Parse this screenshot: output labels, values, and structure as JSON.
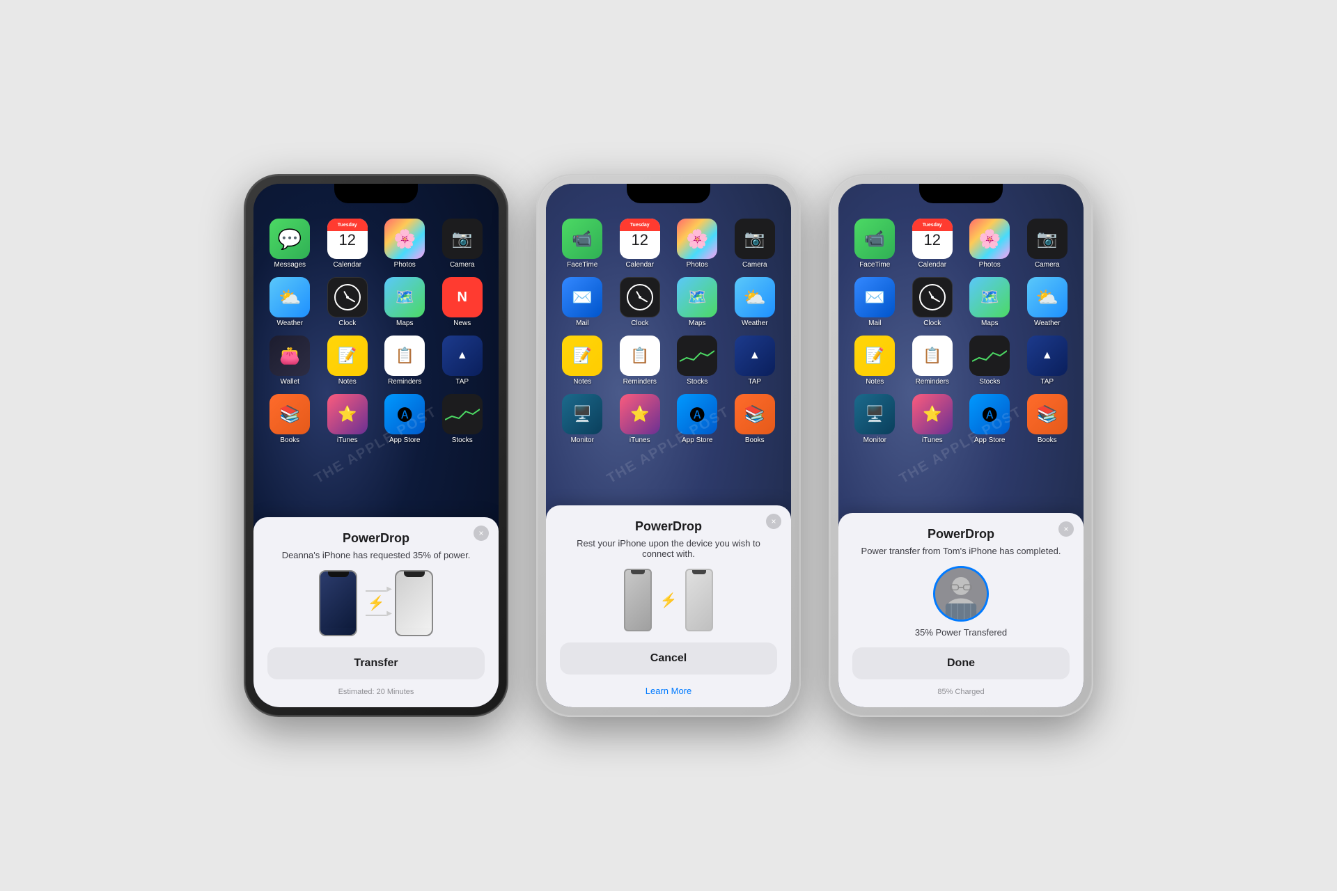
{
  "phones": [
    {
      "id": "phone1",
      "frameStyle": "dark",
      "modal": {
        "title": "PowerDrop",
        "subtitle": "Deanna's iPhone has requested 35% of power.",
        "primaryButton": "Transfer",
        "footnote": "Estimated: 20 Minutes",
        "type": "transfer",
        "closeLabel": "×"
      }
    },
    {
      "id": "phone2",
      "frameStyle": "light",
      "modal": {
        "title": "PowerDrop",
        "subtitle": "Rest your iPhone upon the device you wish to connect with.",
        "primaryButton": "Cancel",
        "learnMore": "Learn More",
        "type": "resting",
        "closeLabel": "×"
      }
    },
    {
      "id": "phone3",
      "frameStyle": "light",
      "modal": {
        "title": "PowerDrop",
        "subtitle": "Power transfer from Tom's iPhone has completed.",
        "primaryButton": "Done",
        "powerPercent": "35% Power Transfered",
        "footnote": "85% Charged",
        "type": "complete",
        "closeLabel": "×"
      }
    }
  ],
  "apps": {
    "row1_phone1": [
      "Messages",
      "Calendar",
      "Photos",
      "Camera"
    ],
    "row2_phone1": [
      "Weather",
      "Clock",
      "Maps",
      "News"
    ],
    "row3_phone1": [
      "Wallet",
      "Notes",
      "Reminders",
      "TAP"
    ],
    "row4_phone1": [
      "Books",
      "iTunes",
      "App Store",
      "Stocks"
    ],
    "row1_phone2": [
      "FaceTime",
      "Calendar",
      "Photos",
      "Camera"
    ],
    "row2_phone2": [
      "Mail",
      "Clock",
      "Maps",
      "Weather"
    ],
    "row3_phone2": [
      "Notes",
      "Reminders",
      "Stocks",
      "TAP"
    ],
    "row4_phone2": [
      "Monitor",
      "iTunes",
      "App Store",
      "Books"
    ],
    "row1_phone3": [
      "FaceTime",
      "Calendar",
      "Photos",
      "Camera"
    ],
    "row2_phone3": [
      "Mail",
      "Clock",
      "Maps",
      "Weather"
    ],
    "row3_phone3": [
      "Notes",
      "Reminders",
      "Stocks",
      "TAP"
    ],
    "row4_phone3": [
      "Monitor",
      "iTunes",
      "App Store",
      "Books"
    ]
  },
  "watermark": "THE APPLE POST",
  "calendarDay": "Tuesday",
  "calendarDate": "12",
  "icons": {
    "close": "×",
    "lightning": "⚡",
    "arrow": "→"
  }
}
